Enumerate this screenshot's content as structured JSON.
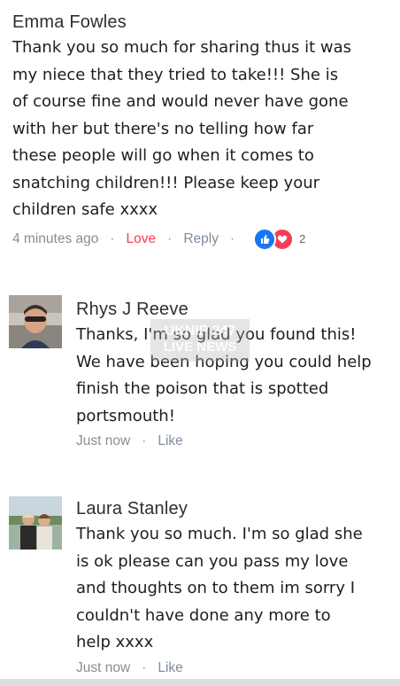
{
  "comments": [
    {
      "name": "Emma Fowles",
      "text": "Thank you so much for sharing thus it was\nmy niece that they tried to take!!! She is\nof course fine and would never have gone\nwith her but there's no telling how far\nthese people will go when it comes to\nsnatching children!!! Please keep your\nchildren safe xxxx",
      "time": "4 minutes ago",
      "reaction_label": "Love",
      "reply_label": "Reply",
      "reaction_count": "2"
    },
    {
      "name": "Rhys J Reeve",
      "text": "Thanks, I'm so glad you found this!\nWe have been hoping you could help\nfinish the poison that is spotted\nportsmouth!",
      "time": "Just now",
      "like_label": "Like"
    },
    {
      "name": "Laura Stanley",
      "text": "Thank you so much. I'm so glad she\nis ok please can you pass my love\nand thoughts on to them im sorry I\ncouldn't  have done any more to\nhelp xxxx",
      "time": "Just now",
      "like_label": "Like"
    }
  ],
  "watermark": {
    "line1": "UKNIP 247",
    "line2": "LIVE NEWS"
  },
  "colors": {
    "love": "#f33e58",
    "like_reaction": "#1877f2",
    "meta": "#8a8d91"
  }
}
